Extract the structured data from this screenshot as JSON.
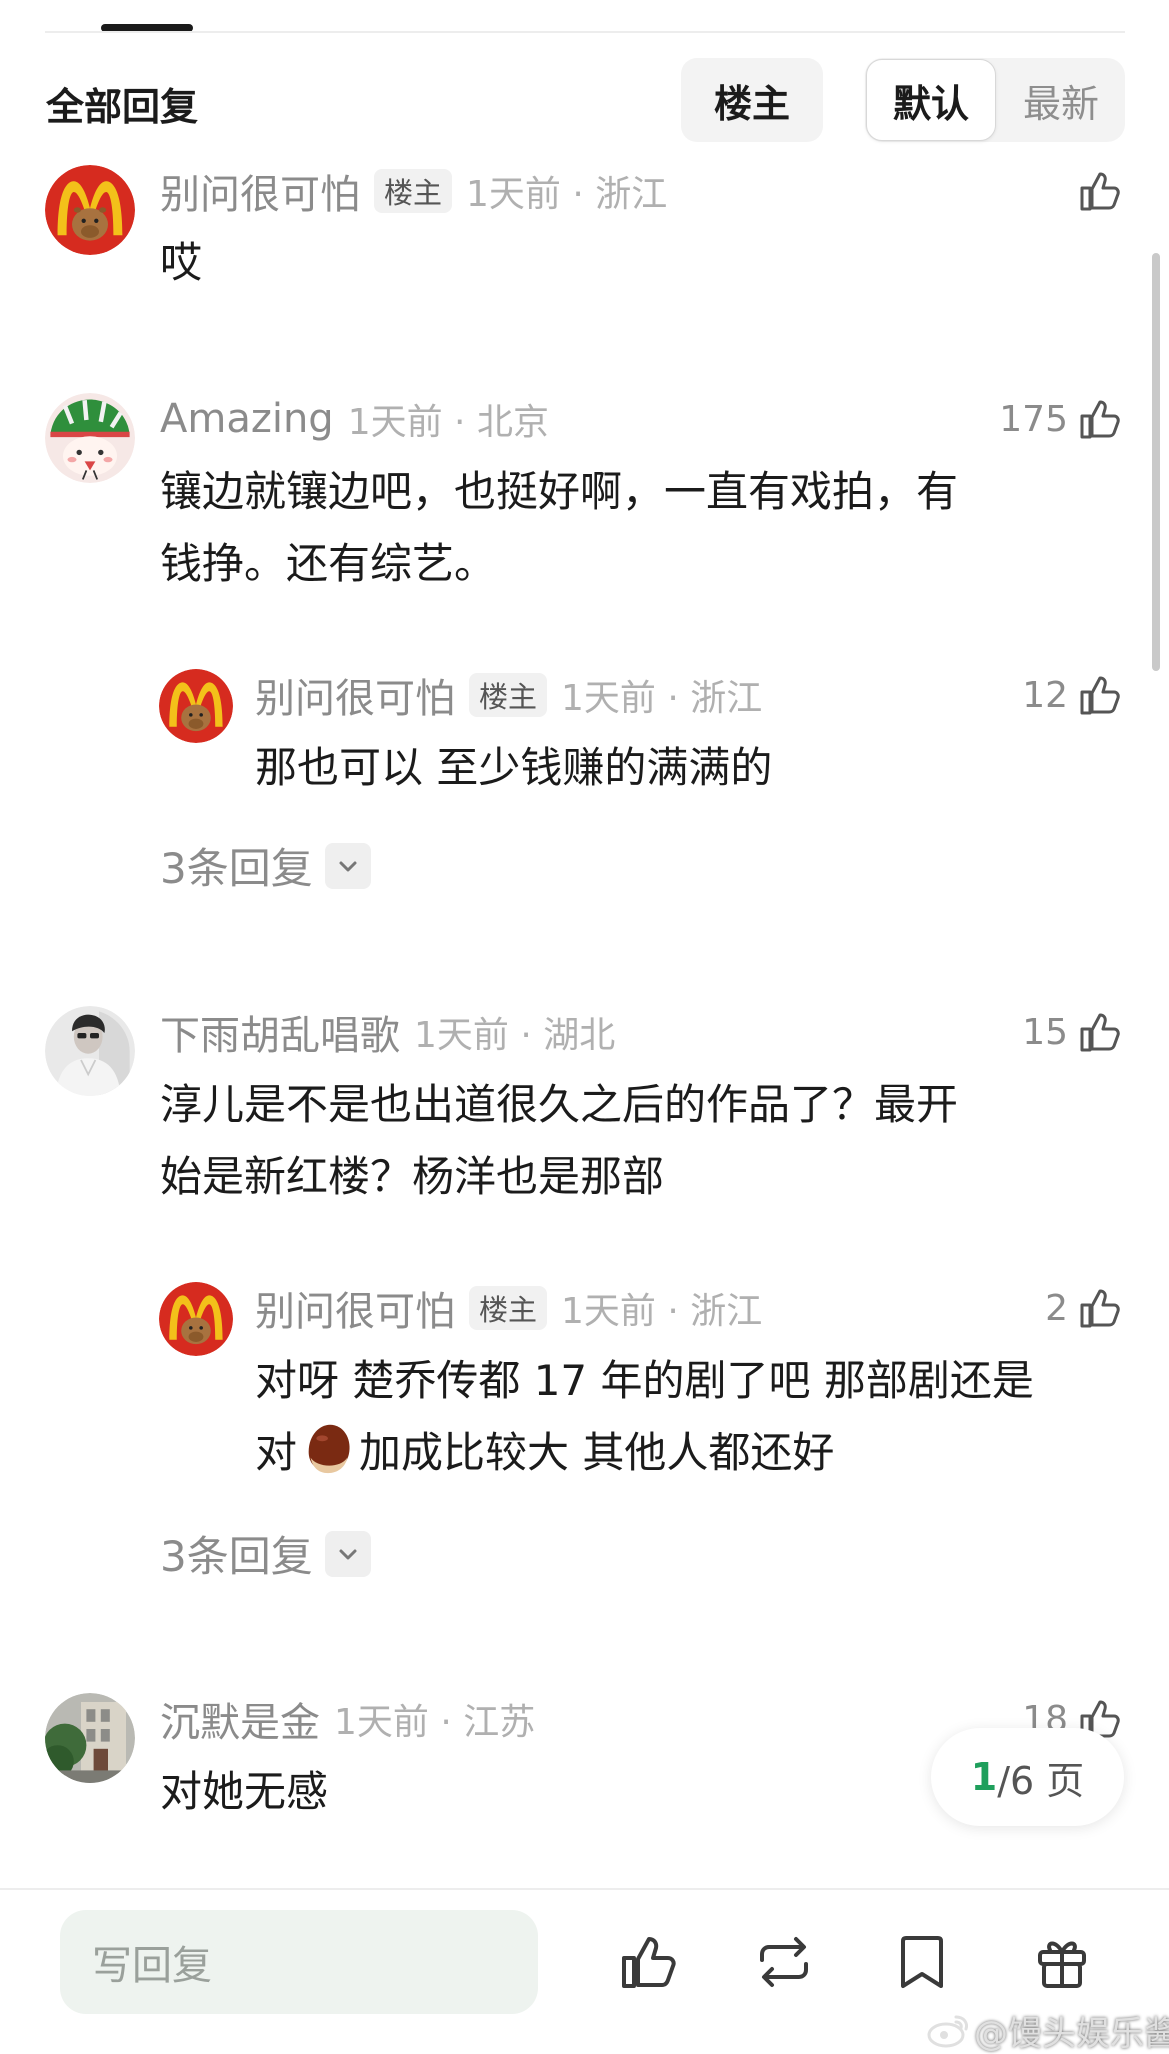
{
  "header": {
    "title": "全部回复",
    "owner_filter": "楼主",
    "sort_default": "默认",
    "sort_newest": "最新"
  },
  "comments": [
    {
      "user": "别问很可怕",
      "tag": "楼主",
      "time": "1天前 · 浙江",
      "likes": "",
      "lines": [
        "哎"
      ]
    },
    {
      "user": "Amazing",
      "tag": "",
      "time": "1天前 · 北京",
      "likes": "175",
      "lines": [
        "镶边就镶边吧，也挺好啊，一直有戏拍，有",
        "钱挣。还有综艺。"
      ],
      "reply": {
        "user": "别问很可怕",
        "tag": "楼主",
        "time": "1天前 · 浙江",
        "likes": "12",
        "lines": [
          "那也可以 至少钱赚的满满的"
        ]
      },
      "more": "3条回复"
    },
    {
      "user": "下雨胡乱唱歌",
      "tag": "",
      "time": "1天前 · 湖北",
      "likes": "15",
      "lines": [
        "淳儿是不是也出道很久之后的作品了？最开",
        "始是新红楼？杨洋也是那部"
      ],
      "reply": {
        "user": "别问很可怕",
        "tag": "楼主",
        "time": "1天前 · 浙江",
        "likes": "2",
        "line1": "对呀 楚乔传都 17 年的剧了吧 那部剧还是",
        "line2_pre": "对",
        "line2_post": "加成比较大 其他人都还好",
        "emoji": "chestnut-emoji"
      },
      "more": "3条回复"
    },
    {
      "user": "沉默是金",
      "tag": "",
      "time": "1天前 · 江苏",
      "likes": "18",
      "lines": [
        "对她无感"
      ]
    }
  ],
  "pager": {
    "current": "1",
    "rest": "/6 页"
  },
  "bottom_bar": {
    "reply_placeholder": "写回复",
    "icons": [
      "thumbs-up-icon",
      "repost-icon",
      "bookmark-icon",
      "gift-icon"
    ]
  },
  "watermark": "@馒头娱乐酱",
  "colors": {
    "mcd_red": "#d62b1f",
    "mcd_gold": "#f3c11a",
    "page_green": "#1f9f5c",
    "meta_gray": "#8b8b8b"
  }
}
